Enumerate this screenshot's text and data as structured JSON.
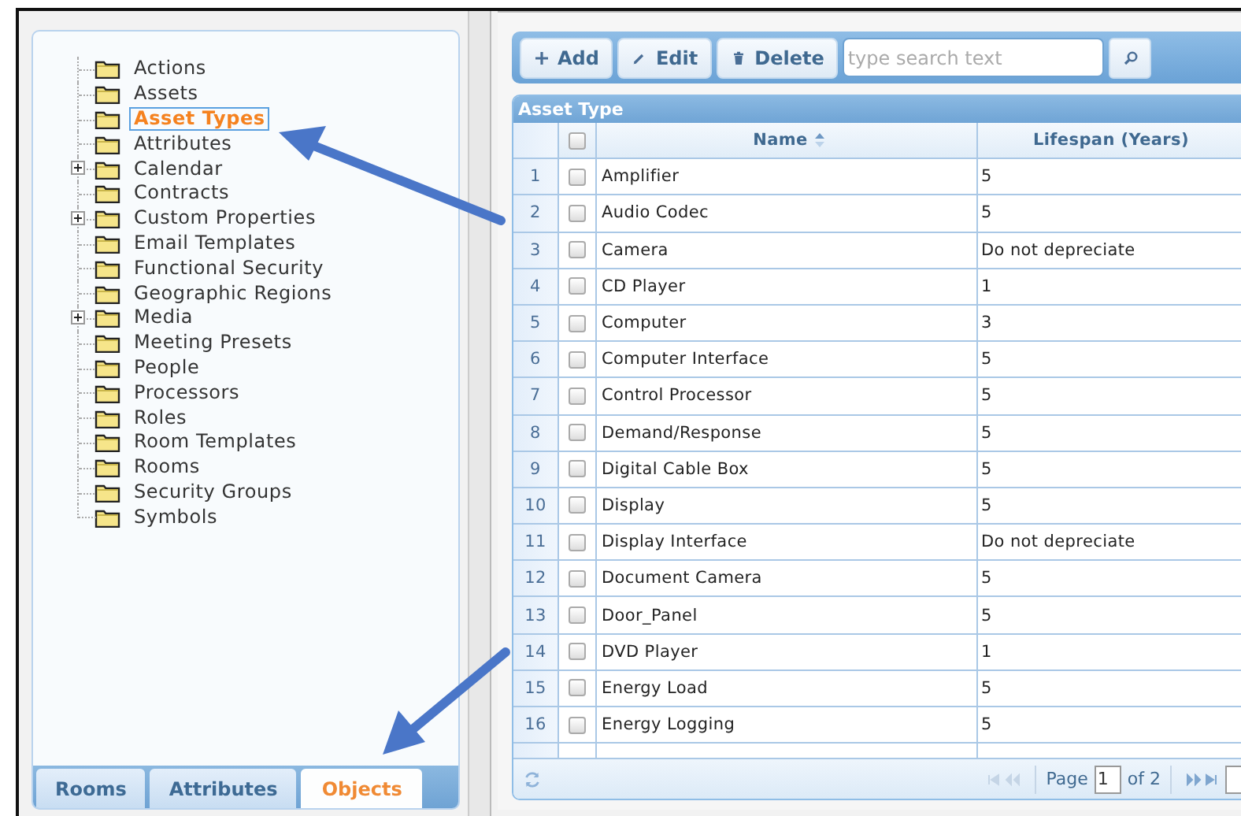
{
  "tree": {
    "items": [
      {
        "label": "Actions",
        "collapsed": false,
        "selected": false
      },
      {
        "label": "Assets",
        "collapsed": false,
        "selected": false
      },
      {
        "label": "Asset Types",
        "collapsed": false,
        "selected": true
      },
      {
        "label": "Attributes",
        "collapsed": false,
        "selected": false
      },
      {
        "label": "Calendar",
        "collapsed": true,
        "selected": false
      },
      {
        "label": "Contracts",
        "collapsed": false,
        "selected": false
      },
      {
        "label": "Custom Properties",
        "collapsed": true,
        "selected": false
      },
      {
        "label": "Email Templates",
        "collapsed": false,
        "selected": false
      },
      {
        "label": "Functional Security",
        "collapsed": false,
        "selected": false
      },
      {
        "label": "Geographic Regions",
        "collapsed": false,
        "selected": false
      },
      {
        "label": "Media",
        "collapsed": true,
        "selected": false
      },
      {
        "label": "Meeting Presets",
        "collapsed": false,
        "selected": false
      },
      {
        "label": "People",
        "collapsed": false,
        "selected": false
      },
      {
        "label": "Processors",
        "collapsed": false,
        "selected": false
      },
      {
        "label": "Roles",
        "collapsed": false,
        "selected": false
      },
      {
        "label": "Room Templates",
        "collapsed": false,
        "selected": false
      },
      {
        "label": "Rooms",
        "collapsed": false,
        "selected": false
      },
      {
        "label": "Security Groups",
        "collapsed": false,
        "selected": false
      },
      {
        "label": "Symbols",
        "collapsed": false,
        "selected": false
      }
    ]
  },
  "tabs": [
    {
      "label": "Rooms",
      "selected": false
    },
    {
      "label": "Attributes",
      "selected": false
    },
    {
      "label": "Objects",
      "selected": true
    }
  ],
  "toolbar": {
    "buttons": [
      {
        "kind": "add",
        "label": "Add"
      },
      {
        "kind": "edit",
        "label": "Edit"
      },
      {
        "kind": "delete",
        "label": "Delete"
      }
    ],
    "search": {
      "placeholder": "type search text"
    }
  },
  "grid": {
    "title": "Asset Type",
    "all_checked": false,
    "columns": [
      {
        "label": "Name",
        "sorted": true
      },
      {
        "label": "Lifespan (Years)",
        "sorted": false
      }
    ],
    "rows": [
      {
        "number": "1",
        "checked": false,
        "name": "Amplifier",
        "lifespan": "5"
      },
      {
        "number": "2",
        "checked": false,
        "name": "Audio Codec",
        "lifespan": "5"
      },
      {
        "number": "3",
        "checked": false,
        "name": "Camera",
        "lifespan": "Do not depreciate"
      },
      {
        "number": "4",
        "checked": false,
        "name": "CD Player",
        "lifespan": "1"
      },
      {
        "number": "5",
        "checked": false,
        "name": "Computer",
        "lifespan": "3"
      },
      {
        "number": "6",
        "checked": false,
        "name": "Computer Interface",
        "lifespan": "5"
      },
      {
        "number": "7",
        "checked": false,
        "name": "Control Processor",
        "lifespan": "5"
      },
      {
        "number": "8",
        "checked": false,
        "name": "Demand/Response",
        "lifespan": "5"
      },
      {
        "number": "9",
        "checked": false,
        "name": "Digital Cable Box",
        "lifespan": "5"
      },
      {
        "number": "10",
        "checked": false,
        "name": "Display",
        "lifespan": "5"
      },
      {
        "number": "11",
        "checked": false,
        "name": "Display Interface",
        "lifespan": "Do not depreciate"
      },
      {
        "number": "12",
        "checked": false,
        "name": "Document Camera",
        "lifespan": "5"
      },
      {
        "number": "13",
        "checked": false,
        "name": "Door_Panel",
        "lifespan": "5"
      },
      {
        "number": "14",
        "checked": false,
        "name": "DVD Player",
        "lifespan": "1"
      },
      {
        "number": "15",
        "checked": false,
        "name": "Energy Load",
        "lifespan": "5"
      },
      {
        "number": "16",
        "checked": false,
        "name": "Energy Logging",
        "lifespan": "5"
      }
    ]
  },
  "pager": {
    "label": "Page",
    "page": "1",
    "total": "of 2"
  }
}
